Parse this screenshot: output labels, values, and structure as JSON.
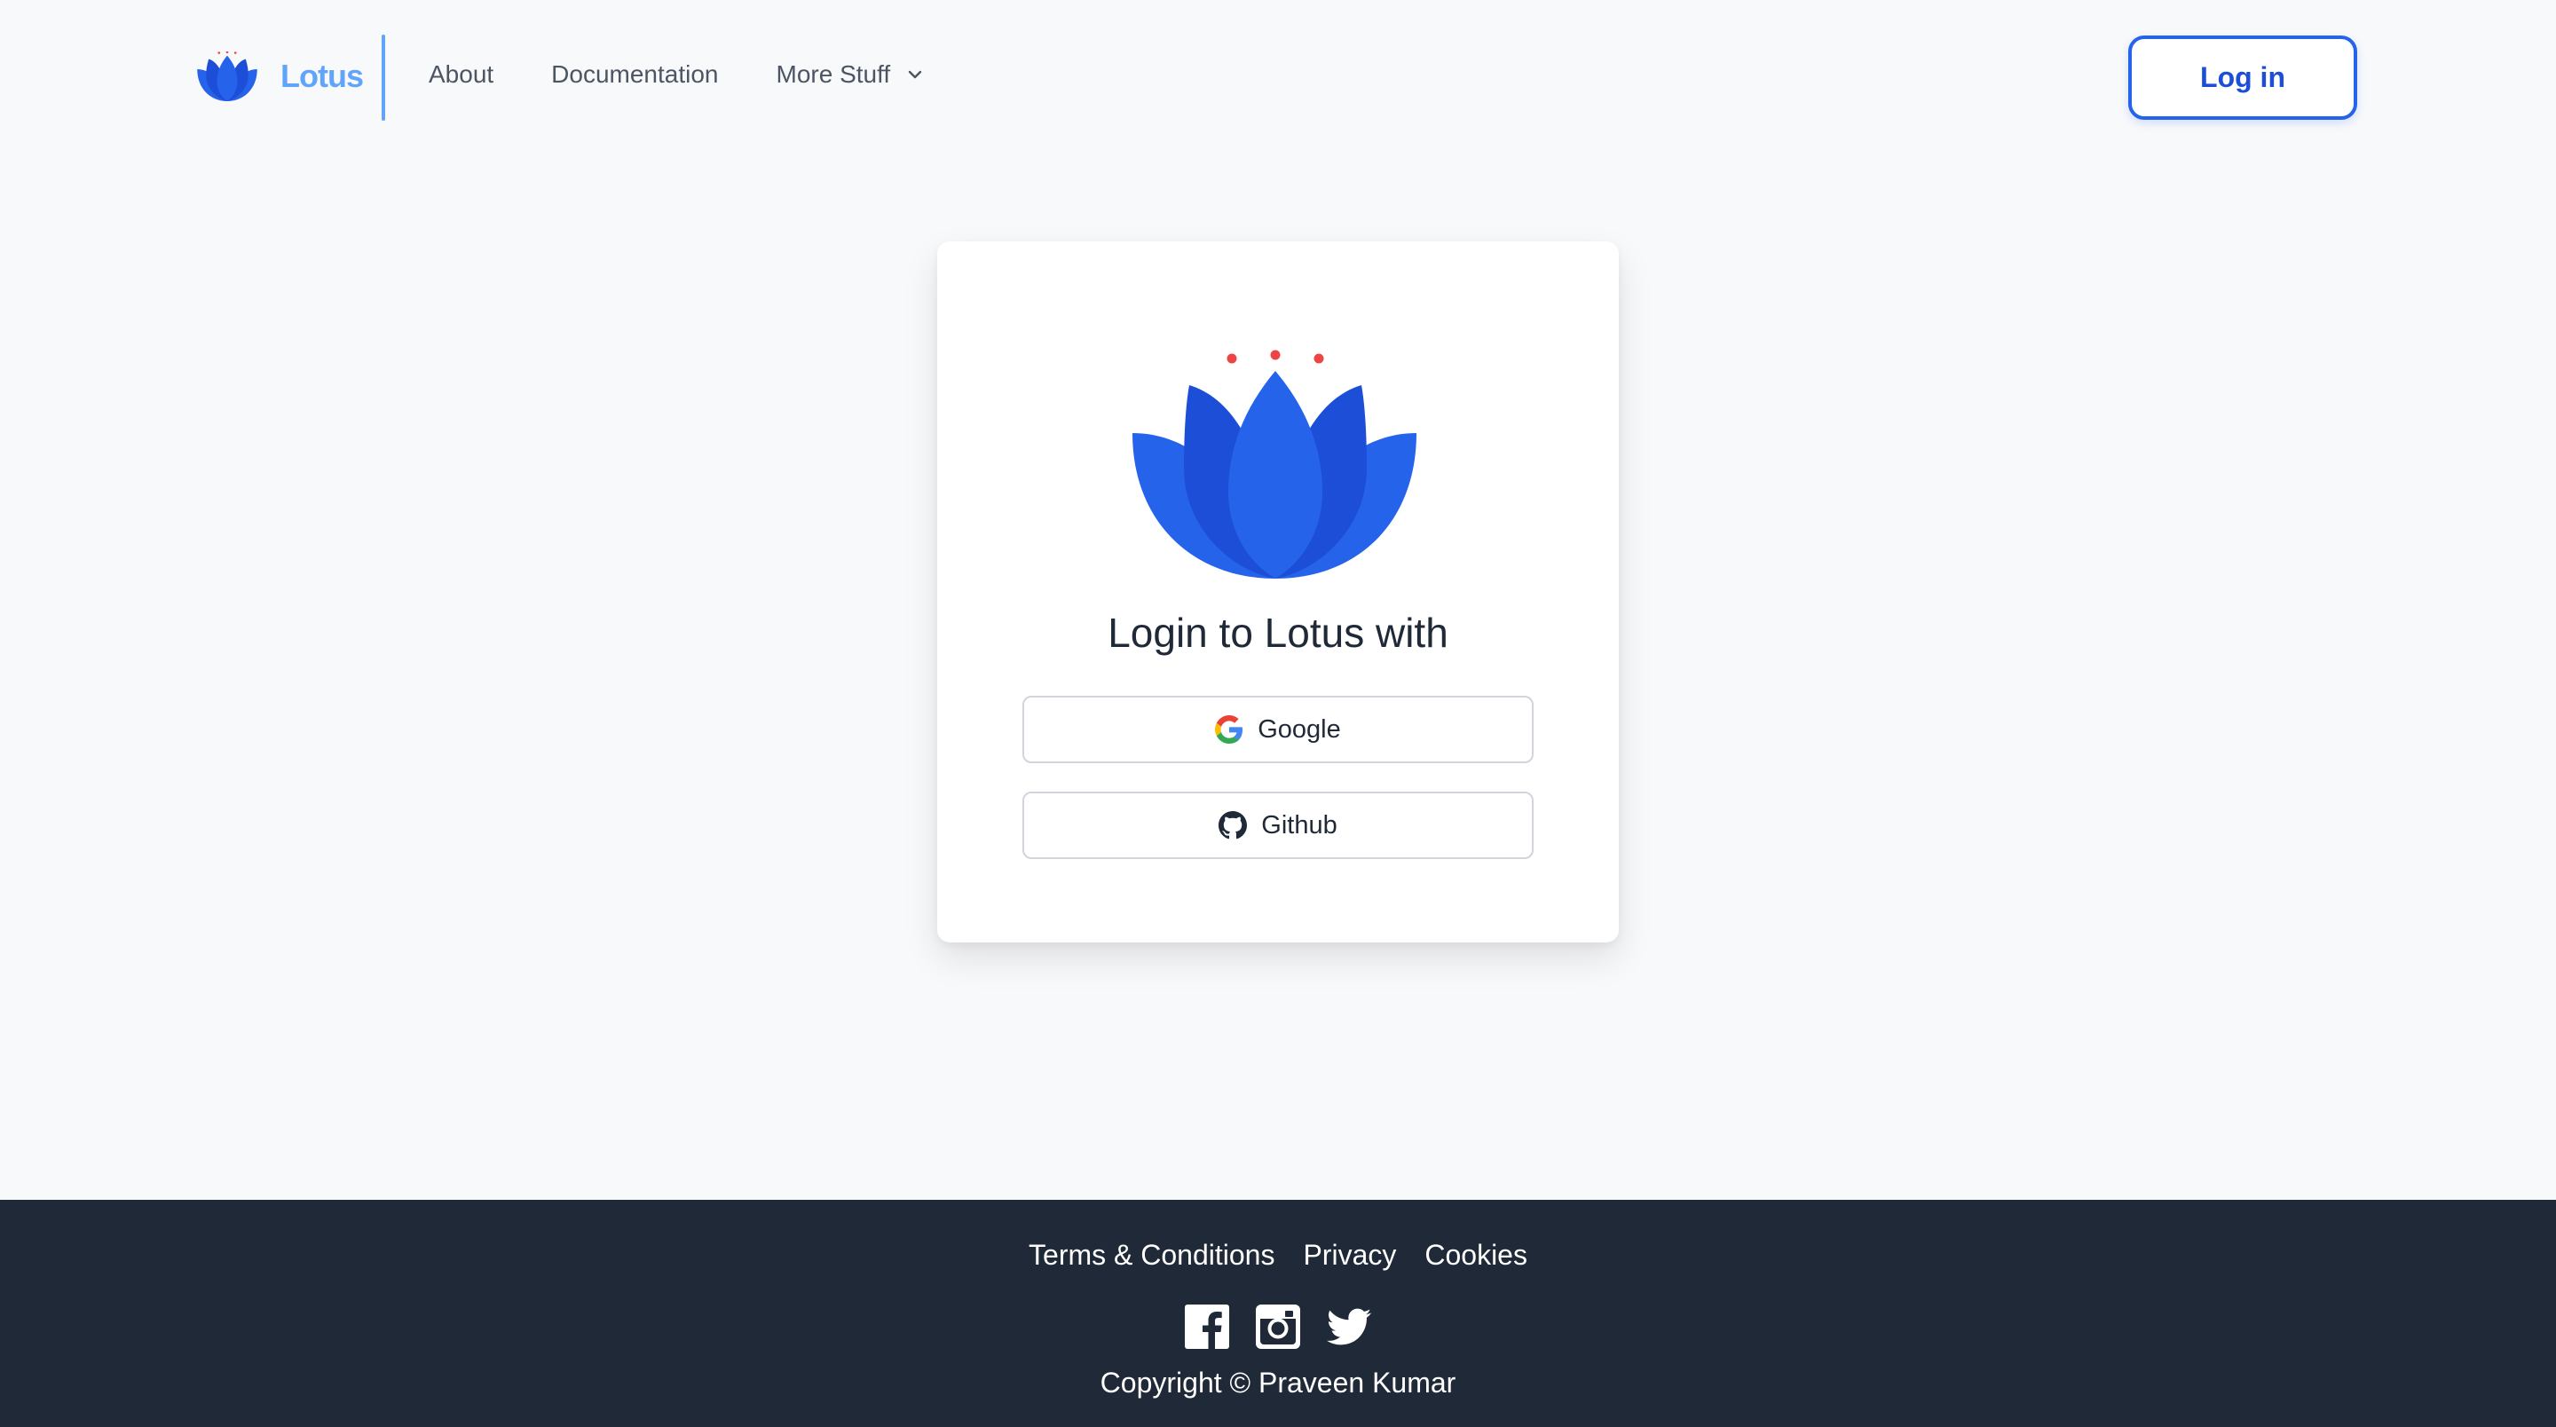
{
  "header": {
    "brand_name": "Lotus",
    "nav": [
      {
        "label": "About"
      },
      {
        "label": "Documentation"
      },
      {
        "label": "More Stuff"
      }
    ],
    "login_label": "Log in"
  },
  "login_card": {
    "title": "Login to Lotus with",
    "providers": [
      {
        "label": "Google",
        "icon": "google-icon"
      },
      {
        "label": "Github",
        "icon": "github-icon"
      }
    ]
  },
  "footer": {
    "links": [
      "Terms & Conditions",
      "Privacy",
      "Cookies"
    ],
    "social_icons": [
      "facebook-icon",
      "instagram-icon",
      "twitter-icon"
    ],
    "copyright": "Copyright © Praveen Kumar"
  },
  "colors": {
    "brand_blue": "#2563eb",
    "brand_light": "#60a5fa",
    "footer_bg": "#1f2937",
    "page_bg": "#f8f9fb",
    "dot_red": "#ef4444"
  }
}
